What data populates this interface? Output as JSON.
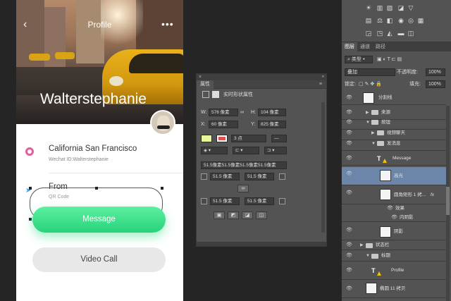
{
  "artboard": {
    "title": "Profile",
    "back_icon": "chevron-left-icon",
    "more_icon": "more-dots-icon",
    "more_glyph": "•••",
    "username": "Walterstephanie",
    "location": "California San Francisco",
    "wechat": "Wechat ID:Walterstephanie",
    "from_label": "From",
    "qr_label": "QR Code",
    "message_button": "Message",
    "video_button": "Video Call",
    "accent_green": "#35de86",
    "pink_icon_color": "#e2609a",
    "blue_icon_color": "#3ba3e8"
  },
  "properties": {
    "panel_title": "属性",
    "section_label": "实时形状属性",
    "w_label": "W:",
    "w_value": "576 像素",
    "h_label": "H:",
    "h_value": "104 像素",
    "x_label": "X:",
    "x_value": "60 像素",
    "y_label": "Y:",
    "y_value": "825 像素",
    "stroke_size": "3 点",
    "corners_all": "51.5像素51.5像素51.5像素51.5像素",
    "corner_tl": "51.5 像素",
    "corner_tr": "51.5 像素",
    "corner_bl": "51.5 像素",
    "corner_br": "51.5 像素",
    "fill_color": "#e8f79a",
    "stroke_color": "#d9534f"
  },
  "layers_panel": {
    "tabs": [
      "图层",
      "通道",
      "路径"
    ],
    "kind_label": "类型",
    "blend_mode": "叠加",
    "opacity_label": "不透明度:",
    "opacity_value": "100%",
    "lock_label": "锁定:",
    "fill_label": "填充:",
    "fill_value": "100%",
    "layers": [
      {
        "name": "分割线",
        "type": "shape"
      },
      {
        "name": "来源",
        "type": "group"
      },
      {
        "name": "按钮",
        "type": "group"
      },
      {
        "name": "视频聊天",
        "type": "group"
      },
      {
        "name": "发消息",
        "type": "group"
      },
      {
        "name": "Message",
        "type": "text"
      },
      {
        "name": "高光",
        "type": "shape",
        "selected": true
      },
      {
        "name": "圆角矩形 1 拷...",
        "type": "shape",
        "fx": "fx"
      },
      {
        "name": "效果",
        "type": "effect"
      },
      {
        "name": "内阴影",
        "type": "effect"
      },
      {
        "name": "阴影",
        "type": "shape"
      },
      {
        "name": "状态栏",
        "type": "group"
      },
      {
        "name": "标题",
        "type": "group"
      },
      {
        "name": "Profile",
        "type": "text"
      },
      {
        "name": "椭圆 11 拷贝",
        "type": "shape"
      }
    ]
  }
}
